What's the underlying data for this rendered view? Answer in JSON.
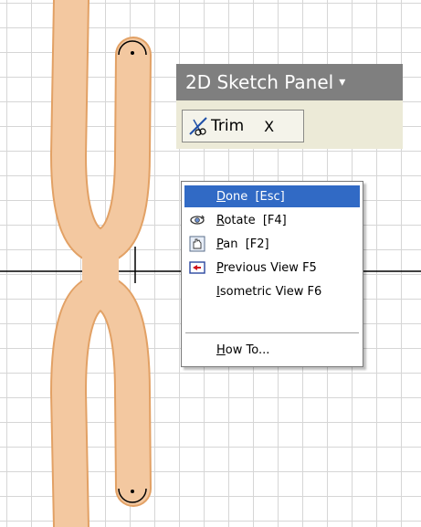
{
  "panel": {
    "title": "2D Sketch Panel",
    "dropdown_glyph": "▾",
    "tool": {
      "label": "Trim",
      "close": "X",
      "icon": "trim-icon"
    }
  },
  "context_menu": {
    "items": [
      {
        "label": "Done  [Esc]",
        "accel": "D",
        "rest": "one  [Esc]",
        "icon": "",
        "highlighted": true
      },
      {
        "label": "Rotate  [F4]",
        "accel": "R",
        "rest": "otate  [F4]",
        "icon": "rotate-icon",
        "highlighted": false
      },
      {
        "label": "Pan  [F2]",
        "accel": "P",
        "rest": "an  [F2]",
        "icon": "pan-icon",
        "highlighted": false
      },
      {
        "label": "Previous View F5",
        "accel": "P",
        "rest": "revious View F5",
        "icon": "previous-view-icon",
        "highlighted": false
      },
      {
        "label": "Isometric View F6",
        "accel": "I",
        "rest": "sometric View F6",
        "icon": "",
        "highlighted": false
      },
      {
        "label": "How To...",
        "accel": "H",
        "rest": "ow To...",
        "icon": "",
        "highlighted": false
      }
    ]
  },
  "colors": {
    "highlight": "#316ac5",
    "slot_fill": "#f3c8a0",
    "slot_stroke": "#e2a165",
    "panel_header": "#7f7f7f",
    "panel_body": "#ecead7"
  }
}
